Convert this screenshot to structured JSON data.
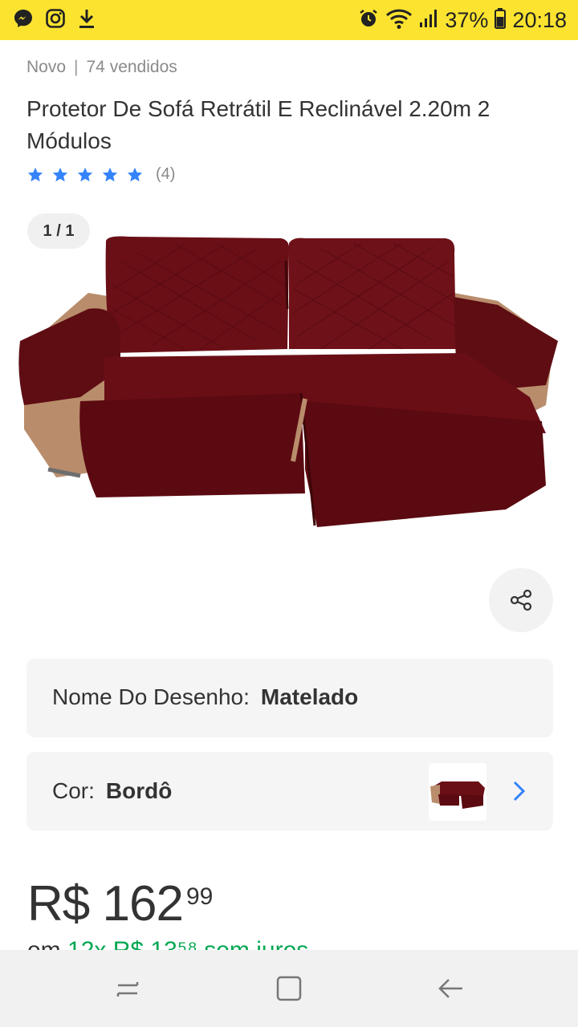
{
  "status_bar": {
    "battery": "37%",
    "time": "20:18",
    "icons": [
      "messenger-icon",
      "instagram-icon",
      "download-icon",
      "alarm-icon",
      "wifi-icon",
      "signal-icon",
      "battery-icon"
    ]
  },
  "product": {
    "condition": "Novo",
    "separator": "|",
    "sold": "74 vendidos",
    "title": "Protetor De Sofá Retrátil E Reclinável 2.20m 2 Módulos",
    "rating_stars": 5,
    "rating_count": "(4)",
    "image_pager": "1 / 1",
    "image_subject": "sofa-cover-burgundy"
  },
  "variations": {
    "design_label": "Nome Do Desenho:",
    "design_value": "Matelado",
    "color_label": "Cor:",
    "color_value": "Bordô"
  },
  "price": {
    "main": "R$ 162",
    "cents": "99"
  },
  "installments": {
    "prefix": "em",
    "highlight": "12x R$ 13⁵⁸",
    "suffix": "sem juros"
  },
  "colors": {
    "status_bar": "#fbe330",
    "star": "#3483fa",
    "link": "#3483fa",
    "green": "#00a650",
    "sofa": "#6e1016"
  }
}
